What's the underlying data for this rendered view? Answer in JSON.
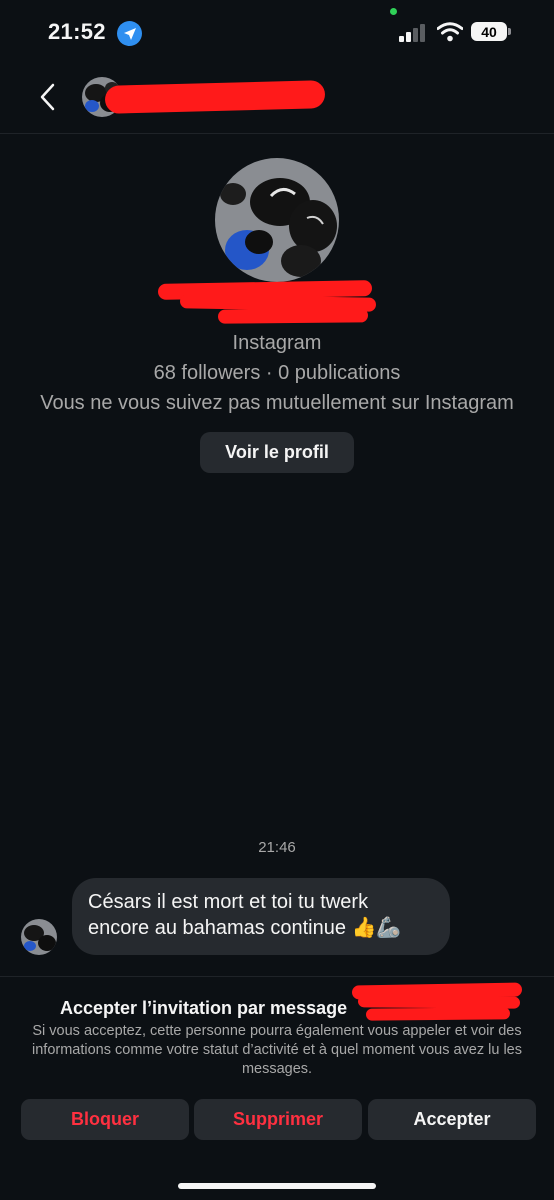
{
  "status_bar": {
    "time": "21:52",
    "battery": "40"
  },
  "conversation": {
    "source": "Instagram",
    "stats": "68 followers · 0 publications",
    "mutual_text": "Vous ne vous suivez pas mutuellement sur Instagram",
    "view_profile_label": "Voir le profil"
  },
  "messages": [
    {
      "time": "21:46",
      "text": "Césars il est mort et toi tu twerk encore au bahamas continue 👍🦾"
    }
  ],
  "request": {
    "title": "Accepter l’invitation par message",
    "description": "Si vous acceptez, cette personne pourra également vous appeler et voir des informations comme votre statut d’activité et à quel moment vous avez lu les messages.",
    "block_label": "Bloquer",
    "delete_label": "Supprimer",
    "accept_label": "Accepter"
  },
  "colors": {
    "background": "#0c1014",
    "danger": "#ff3040",
    "surface": "#262a2f",
    "muted": "#a8a8a8",
    "redaction": "#ff1a1a"
  },
  "icons": [
    "location-arrow-icon",
    "signal-icon",
    "wifi-icon",
    "battery-icon",
    "back-chevron-icon"
  ]
}
